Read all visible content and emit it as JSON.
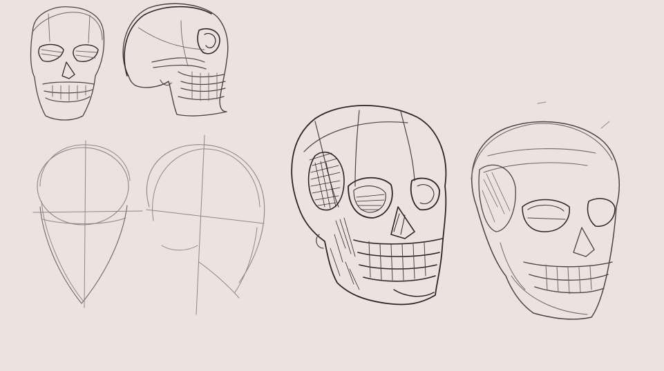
{
  "canvas": {
    "background": "#ece3e1",
    "stroke_color": "#2a2424"
  },
  "sketches": [
    {
      "name": "skull-front-small"
    },
    {
      "name": "skull-side-small"
    },
    {
      "name": "head-construction-front"
    },
    {
      "name": "head-construction-side"
    },
    {
      "name": "skull-three-quarter-shaded"
    },
    {
      "name": "skull-three-quarter-outline"
    }
  ]
}
